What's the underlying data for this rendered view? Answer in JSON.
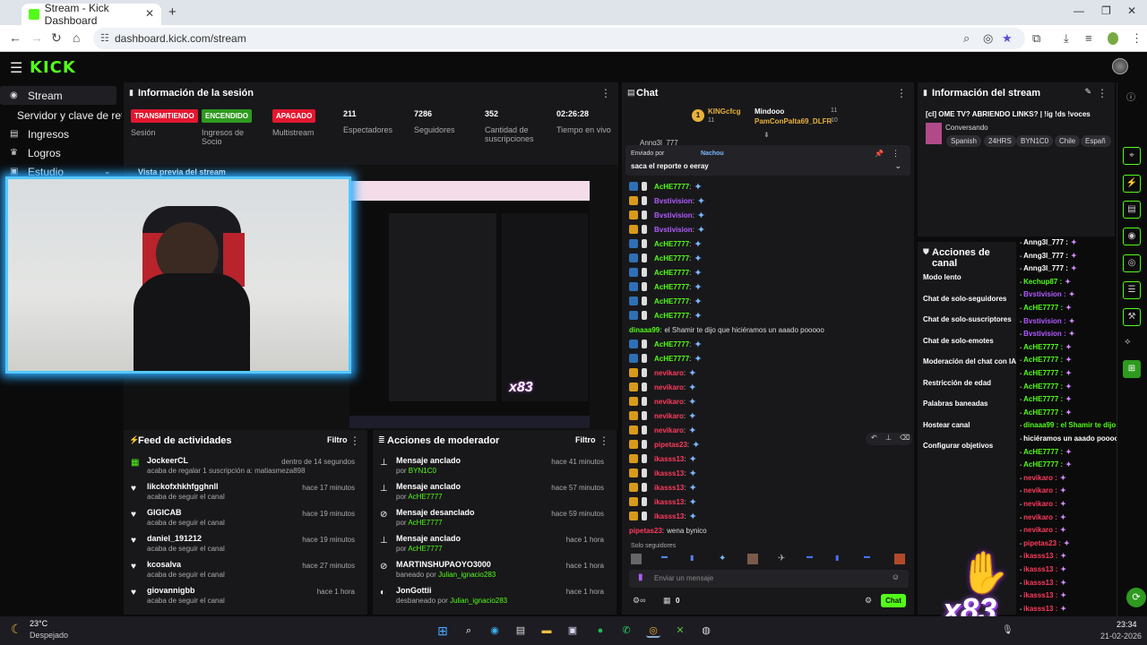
{
  "browser": {
    "tab_title": "Stream - Kick Dashboard",
    "url": "dashboard.kick.com/stream"
  },
  "kick": {
    "logo": "KICK"
  },
  "sidebar": {
    "items": [
      {
        "label": "Stream",
        "icon": "broadcast-icon"
      },
      {
        "label": "Servidor y clave de retransmisión",
        "icon": ""
      },
      {
        "label": "Ingresos",
        "icon": "money-icon"
      },
      {
        "label": "Logros",
        "icon": "trophy-icon"
      },
      {
        "label": "Estudio",
        "icon": "studio-icon"
      }
    ]
  },
  "session": {
    "title": "Información de la sesión",
    "badges": [
      {
        "text": "TRANSMITIENDO",
        "label": "Sesión",
        "color": "#e3172f"
      },
      {
        "text": "ENCENDIDO",
        "label": "Ingresos de Socio",
        "color": "#2e9a1f"
      },
      {
        "text": "APAGADO",
        "label": "Multistream",
        "color": "#e3172f"
      }
    ],
    "stats": [
      {
        "value": "211",
        "label": "Espectadores"
      },
      {
        "value": "7286",
        "label": "Seguidores"
      },
      {
        "value": "352",
        "label": "Cantidad de suscripciones"
      },
      {
        "value": "02:26:28",
        "label": "Tiempo en vivo"
      }
    ]
  },
  "preview": {
    "title": "Vista previa del stream",
    "overlay": "x83"
  },
  "feed": {
    "title": "Feed de actividades",
    "filter": "Filtro",
    "items": [
      {
        "name": "JockeerCL",
        "sub": "acaba de regalar 1 suscripción a: matiasmeza898",
        "time": "dentro de 14 segundos",
        "icon": "gift-icon"
      },
      {
        "name": "likckofxhkhfgghnll",
        "sub": "acaba de seguir el canal",
        "time": "hace 17 minutos",
        "icon": "heart-icon"
      },
      {
        "name": "GIGICAB",
        "sub": "acaba de seguir el canal",
        "time": "hace 19 minutos",
        "icon": "heart-icon"
      },
      {
        "name": "daniel_191212",
        "sub": "acaba de seguir el canal",
        "time": "hace 19 minutos",
        "icon": "heart-icon"
      },
      {
        "name": "kcosalva",
        "sub": "acaba de seguir el canal",
        "time": "hace 27 minutos",
        "icon": "heart-icon"
      },
      {
        "name": "giovannigbb",
        "sub": "acaba de seguir el canal",
        "time": "hace 1 hora",
        "icon": "heart-icon"
      }
    ]
  },
  "modactions": {
    "title": "Acciones de moderador",
    "filter": "Filtro",
    "items": [
      {
        "name": "Mensaje anclado",
        "pre": "por",
        "who": "BYN1C0",
        "time": "hace 41 minutos",
        "icon": "pin-icon"
      },
      {
        "name": "Mensaje anclado",
        "pre": "por",
        "who": "AcHE7777",
        "time": "hace 57 minutos",
        "icon": "pin-icon"
      },
      {
        "name": "Mensaje desanclado",
        "pre": "por",
        "who": "AcHE7777",
        "time": "hace 59 minutos",
        "icon": "unpin-icon"
      },
      {
        "name": "Mensaje anclado",
        "pre": "por",
        "who": "AcHE7777",
        "time": "hace 1 hora",
        "icon": "pin-icon"
      },
      {
        "name": "MARTINSHUPAOYO3000",
        "pre": "baneado por",
        "who": "Julian_ignacio283",
        "time": "hace 1 hora",
        "icon": "ban-icon"
      },
      {
        "name": "JonGottii",
        "pre": "desbaneado por",
        "who": "Julian_ignacio283",
        "time": "hace 1 hora",
        "icon": "unban-icon"
      }
    ]
  },
  "chat": {
    "title": "Chat",
    "top_gifters": [
      {
        "name": "KINGcfcg",
        "count": "11"
      },
      {
        "name": "Mindooo",
        "count": "11"
      },
      {
        "name": "PamConPalta69_DLFR",
        "count": "10"
      }
    ],
    "pinned_by": "Enviado por",
    "pinned_user": "Nachou",
    "pinned_msg": "saca el reporte o eeray",
    "partial_user": "Anng3l_777",
    "messages": [
      {
        "user": "AcHE7777",
        "text": "",
        "color": "#53fc18"
      },
      {
        "user": "Bvstivision",
        "text": "",
        "color": "#b15bff"
      },
      {
        "user": "Bvstivision",
        "text": "",
        "color": "#b15bff"
      },
      {
        "user": "Bvstivision",
        "text": "",
        "color": "#b15bff"
      },
      {
        "user": "AcHE7777",
        "text": "",
        "color": "#53fc18"
      },
      {
        "user": "AcHE7777",
        "text": "",
        "color": "#53fc18"
      },
      {
        "user": "AcHE7777",
        "text": "",
        "color": "#53fc18"
      },
      {
        "user": "AcHE7777",
        "text": "",
        "color": "#53fc18"
      },
      {
        "user": "AcHE7777",
        "text": "",
        "color": "#53fc18"
      },
      {
        "user": "AcHE7777",
        "text": "",
        "color": "#53fc18"
      },
      {
        "user": "dinaaa99",
        "text": "el Shamir te dijo que hiciéramos un aaado pooooo",
        "color": "#53fc18"
      },
      {
        "user": "AcHE7777",
        "text": "",
        "color": "#53fc18"
      },
      {
        "user": "AcHE7777",
        "text": "",
        "color": "#53fc18"
      },
      {
        "user": "nevikaro",
        "text": "",
        "color": "#ff3b5c"
      },
      {
        "user": "nevikaro",
        "text": "",
        "color": "#ff3b5c"
      },
      {
        "user": "nevikaro",
        "text": "",
        "color": "#ff3b5c"
      },
      {
        "user": "nevikaro",
        "text": "",
        "color": "#ff3b5c"
      },
      {
        "user": "nevikaro",
        "text": "",
        "color": "#ff3b5c"
      },
      {
        "user": "pipetas23",
        "text": "",
        "color": "#ff3b5c"
      },
      {
        "user": "ikasss13",
        "text": "",
        "color": "#ff3b5c"
      },
      {
        "user": "ikasss13",
        "text": "",
        "color": "#ff3b5c"
      },
      {
        "user": "ikasss13",
        "text": "",
        "color": "#ff3b5c"
      },
      {
        "user": "ikasss13",
        "text": "",
        "color": "#ff3b5c"
      },
      {
        "user": "ikasss13",
        "text": "",
        "color": "#ff3b5c"
      },
      {
        "user": "pipetas23",
        "text": "wena bynico",
        "color": "#ff3b5c"
      }
    ],
    "mode": "Solo seguidores",
    "input_placeholder": "Enviar un mensaje",
    "count": "0",
    "send_label": "Chat"
  },
  "streaminfo": {
    "title": "Información del stream",
    "stream_title": "[cl] OME TV? ABRIENDO LINKS? | !ig !ds !voces",
    "category": "Conversando",
    "tags": [
      "Spanish",
      "24HRS",
      "BYN1C0",
      "Chile",
      "Españ"
    ]
  },
  "channel_actions": {
    "title": "Acciones de canal",
    "items": [
      "Modo lento",
      "Chat de solo-seguidores",
      "Chat de solo-suscriptores",
      "Chat de solo-emotes",
      "Moderación del chat con IA",
      "Restricción de edad",
      "Palabras baneadas",
      "Hostear canal",
      "Configurar objetivos"
    ]
  },
  "overlay_chat": {
    "lines": [
      {
        "user": "Anng3l_777 :",
        "color": "#ffffff"
      },
      {
        "user": "Anng3l_777 :",
        "color": "#ffffff"
      },
      {
        "user": "Anng3l_777 :",
        "color": "#ffffff"
      },
      {
        "user": "Kechup87 :",
        "color": "#53fc18"
      },
      {
        "user": "Bvstivision :",
        "color": "#b15bff"
      },
      {
        "user": "AcHE7777 :",
        "color": "#53fc18"
      },
      {
        "user": "Bvstivision :",
        "color": "#b15bff"
      },
      {
        "user": "Bvstivision :",
        "color": "#b15bff"
      },
      {
        "user": "AcHE7777 :",
        "color": "#53fc18"
      },
      {
        "user": "AcHE7777 :",
        "color": "#53fc18"
      },
      {
        "user": "AcHE7777 :",
        "color": "#53fc18"
      },
      {
        "user": "AcHE7777 :",
        "color": "#53fc18"
      },
      {
        "user": "AcHE7777 :",
        "color": "#53fc18"
      },
      {
        "user": "AcHE7777 :",
        "color": "#53fc18"
      },
      {
        "user": "dinaaa99 : el Shamir te dijo que",
        "color": "#53fc18"
      },
      {
        "user": "hiciéramos un aaado pooooo",
        "color": "#ffffff"
      },
      {
        "user": "AcHE7777 :",
        "color": "#53fc18"
      },
      {
        "user": "AcHE7777 :",
        "color": "#53fc18"
      },
      {
        "user": "nevikaro :",
        "color": "#ff3b5c"
      },
      {
        "user": "nevikaro :",
        "color": "#ff3b5c"
      },
      {
        "user": "nevikaro :",
        "color": "#ff3b5c"
      },
      {
        "user": "nevikaro :",
        "color": "#ff3b5c"
      },
      {
        "user": "nevikaro :",
        "color": "#ff3b5c"
      },
      {
        "user": "pipetas23 :",
        "color": "#ff3b5c"
      },
      {
        "user": "ikasss13 :",
        "color": "#ff3b5c"
      },
      {
        "user": "ikasss13 :",
        "color": "#ff3b5c"
      },
      {
        "user": "ikasss13 :",
        "color": "#ff3b5c"
      },
      {
        "user": "ikasss13 :",
        "color": "#ff3b5c"
      },
      {
        "user": "ikasss13 :",
        "color": "#ff3b5c"
      },
      {
        "user": "pipetas23 : wena bynico",
        "color": "#ff3b5c"
      }
    ],
    "big_overlay": "x83"
  },
  "taskbar": {
    "weather_temp": "23°C",
    "weather_desc": "Despejado",
    "time": "23:34",
    "date": "21-02-2026"
  },
  "colors": {
    "accent": "#53fc18",
    "panel": "#18181b",
    "live_red": "#e3172f"
  }
}
